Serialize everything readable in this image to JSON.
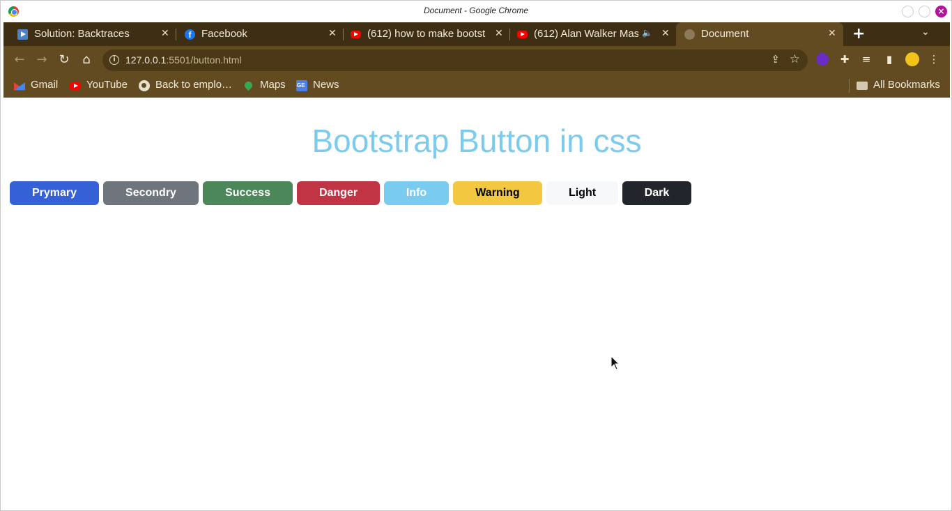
{
  "window": {
    "title": "Document - Google Chrome"
  },
  "tabs": [
    {
      "label": "Solution: Backtraces",
      "favicon": "play-icon"
    },
    {
      "label": "Facebook",
      "favicon": "facebook-icon"
    },
    {
      "label": "(612) how to make bootst",
      "favicon": "youtube-icon"
    },
    {
      "label": "(612) Alan Walker Mas",
      "favicon": "youtube-icon",
      "audio": "speaker-icon"
    },
    {
      "label": "Document",
      "favicon": "globe-icon",
      "active": true
    }
  ],
  "toolbar": {
    "url_host": "127.0.0.1",
    "url_rest": ":5501/button.html"
  },
  "bookmarks": [
    {
      "label": "Gmail",
      "icon": "gmail-icon"
    },
    {
      "label": "YouTube",
      "icon": "youtube-icon"
    },
    {
      "label": "Back to emplo…",
      "icon": "globe-icon"
    },
    {
      "label": "Maps",
      "icon": "maps-icon"
    },
    {
      "label": "News",
      "icon": "news-icon"
    }
  ],
  "all_bookmarks_label": "All Bookmarks",
  "page": {
    "heading": "Bootstrap Button in css",
    "heading_color": "#7ccbec",
    "buttons": [
      {
        "label": "Prymary",
        "bg": "#3561d6",
        "fg": "#ffffff"
      },
      {
        "label": "Secondry",
        "bg": "#6e757d",
        "fg": "#ffffff"
      },
      {
        "label": "Success",
        "bg": "#4b8758",
        "fg": "#ffffff"
      },
      {
        "label": "Danger",
        "bg": "#c03444",
        "fg": "#ffffff"
      },
      {
        "label": "Info",
        "bg": "#79ccef",
        "fg": "#ffffff"
      },
      {
        "label": "Warning",
        "bg": "#f3c73f",
        "fg": "#000000"
      },
      {
        "label": "Light",
        "bg": "#f7f8fa",
        "fg": "#000000"
      },
      {
        "label": "Dark",
        "bg": "#22252b",
        "fg": "#ffffff"
      }
    ]
  },
  "theme": {
    "tab_strip": "#3e2f14",
    "toolbar": "#634b21",
    "close_button": "#b0149c"
  }
}
